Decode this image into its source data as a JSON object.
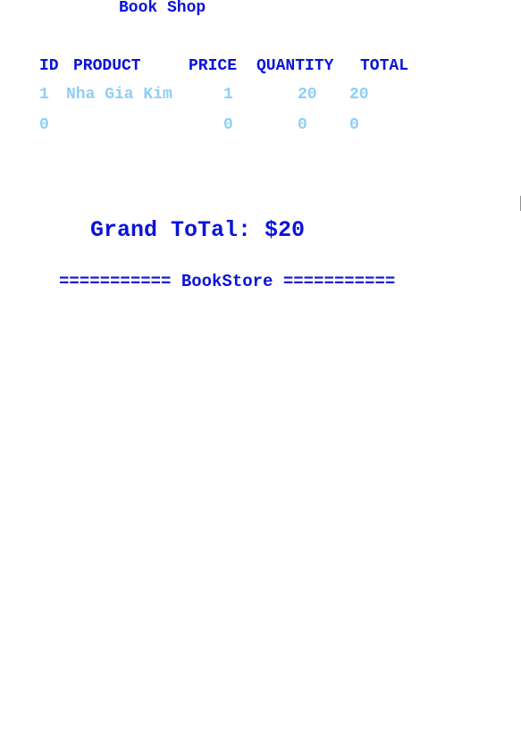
{
  "title": "Book Shop",
  "table": {
    "headers": [
      "ID",
      "PRODUCT",
      "PRICE",
      "QUANTITY",
      "TOTAL"
    ],
    "rows": [
      [
        "1",
        "Nha Gia Kim",
        "1",
        "20",
        "20"
      ],
      [
        "0",
        "",
        "0",
        "0",
        "0"
      ]
    ]
  },
  "grand_total": "Grand ToTal: $20",
  "footer": "=========== BookStore ===========",
  "colors": {
    "heading": "#0a14d8",
    "rows": "#8fcff4",
    "background": "#ffffff"
  },
  "icons": {
    "cursor": "mouse-pointer-icon"
  }
}
